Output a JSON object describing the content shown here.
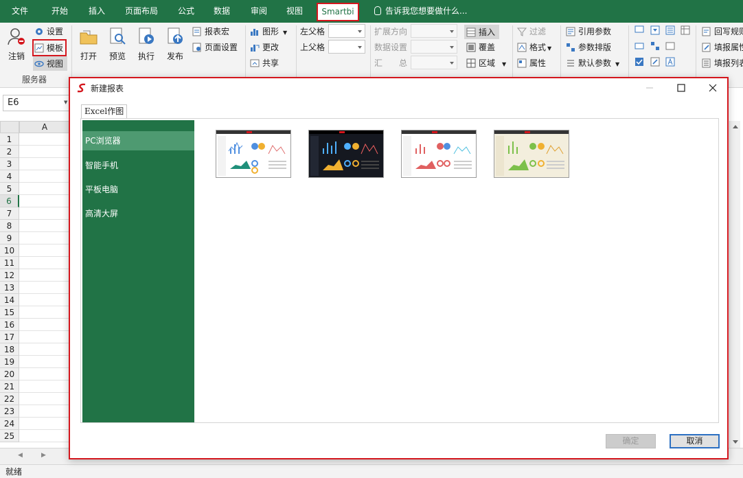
{
  "ribbon_tabs": [
    "文件",
    "开始",
    "插入",
    "页面布局",
    "公式",
    "数据",
    "审阅",
    "视图",
    "Smartbi"
  ],
  "tell_me": "告诉我您想要做什么...",
  "ribbon": {
    "logout": "注销",
    "settings": "设置",
    "template": "模板",
    "view": "视图",
    "group_server": "服务器",
    "open": "打开",
    "preview": "预览",
    "execute": "执行",
    "publish": "发布",
    "report_macro": "报表宏",
    "page_setup": "页面设置",
    "chart": "图形",
    "change": "更改",
    "share": "共享",
    "left_parent": "左父格",
    "top_parent": "上父格",
    "expand_dir": "扩展方向",
    "data_setting": "数据设置",
    "summary": "汇　　总",
    "insert": "插入",
    "overwrite": "覆盖",
    "area": "区域",
    "filter": "过滤",
    "format": "格式",
    "attribute": "属性",
    "ref_param": "引用参数",
    "param_layout": "参数排版",
    "default_param": "默认参数",
    "writeback_rule": "回写规则",
    "fill_attr": "填报属性",
    "fill_list": "填报列表"
  },
  "namebox": "E6",
  "column_a": "A",
  "rows": [
    "1",
    "2",
    "3",
    "4",
    "5",
    "6",
    "7",
    "8",
    "9",
    "10",
    "11",
    "12",
    "13",
    "14",
    "15",
    "16",
    "17",
    "18",
    "19",
    "20",
    "21",
    "22",
    "23",
    "24",
    "25"
  ],
  "status": "就绪",
  "dialog": {
    "title": "新建报表",
    "tab": "Excel作图",
    "nav": [
      "PC浏览器",
      "智能手机",
      "平板电脑",
      "高清大屏"
    ],
    "ok": "确定",
    "cancel": "取消"
  },
  "colors": {
    "excel_green": "#217346",
    "highlight_red": "#d4161d",
    "nav_active": "#4e9a71"
  }
}
